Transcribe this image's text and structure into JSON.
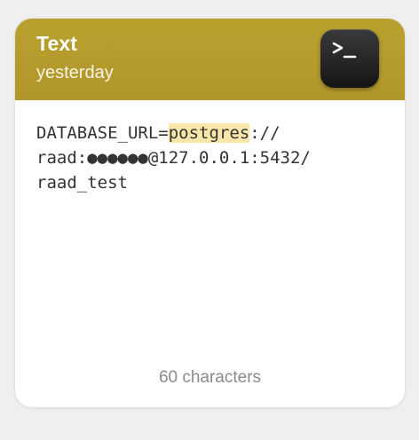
{
  "card": {
    "title": "Text",
    "subtitle": "yesterday",
    "app_icon": "terminal-icon",
    "header_color": "#b49b2c",
    "highlight_color": "#f8e7a8",
    "content_lines": [
      {
        "prefix": "DATABASE_URL=",
        "highlight": "postgres",
        "suffix": "://"
      },
      "raad:●●●●●●@127.0.0.1:5432/",
      "raad_test"
    ],
    "footer": "60 characters"
  }
}
